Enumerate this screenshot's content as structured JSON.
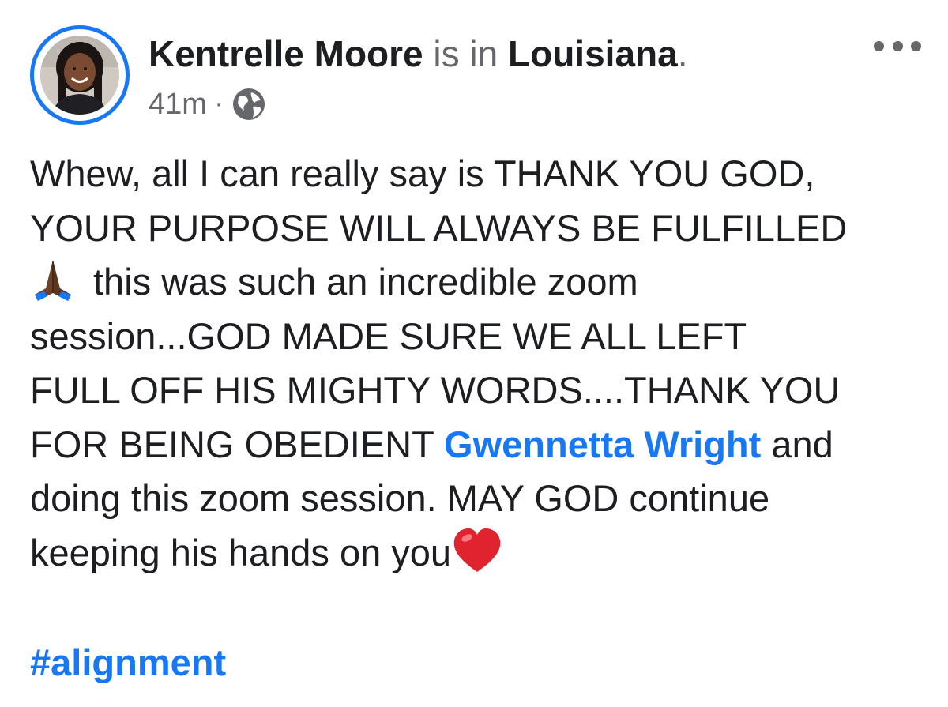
{
  "post": {
    "author": "Kentrelle Moore",
    "location_connector": " is in ",
    "location": "Louisiana",
    "location_end": ".",
    "timestamp": "41m",
    "separator": "·",
    "privacy_icon": "globe-icon",
    "more_icon": "more-options-icon",
    "body_lines": [
      "Whew, all I can really say is THANK YOU GOD,",
      "YOUR PURPOSE WILL ALWAYS BE FULFILLED",
      "this was such an incredible zoom",
      "session...GOD MADE SURE WE ALL LEFT",
      "FULL OFF HIS MIGHTY WORDS....THANK YOU",
      "FOR BEING OBEDIENT ",
      "doing this zoom session. MAY GOD continue",
      "keeping his hands on you"
    ],
    "mention": "Gwennetta Wright",
    "mention_after": " and",
    "pray_emoji": "🙏🏾",
    "heart_emoji": "❤️",
    "hashtag": "#alignment"
  },
  "colors": {
    "accent": "#1877f2",
    "text": "#1c1e21",
    "secondary_text": "#65676b"
  }
}
